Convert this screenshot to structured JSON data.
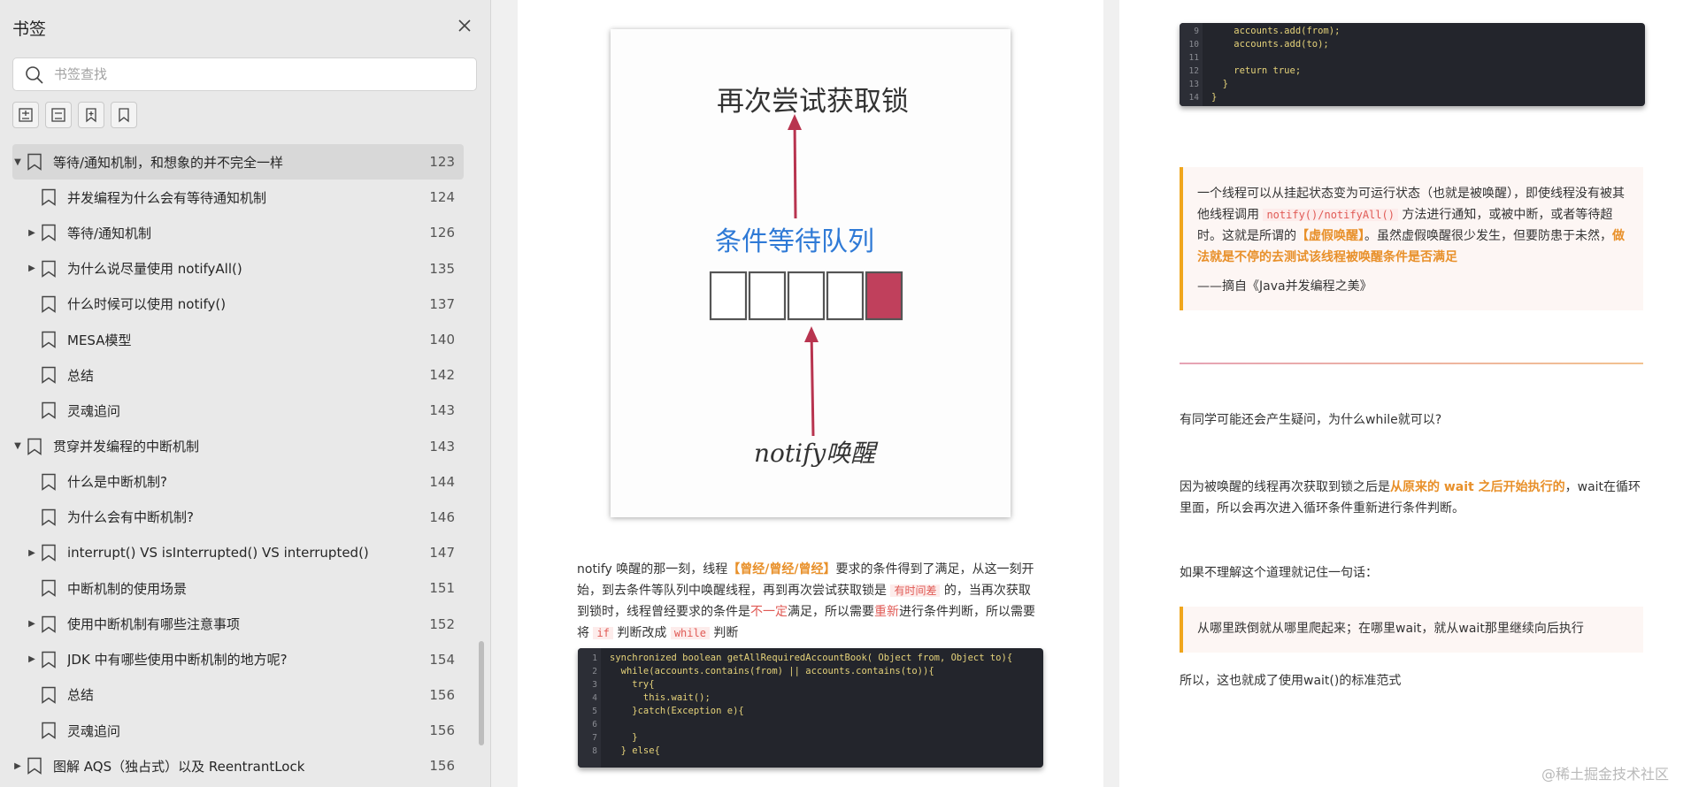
{
  "sidebar": {
    "title": "书签",
    "search_placeholder": "书签查找",
    "items": [
      {
        "label": "等待/通知机制，和想象的并不完全一样",
        "page": "123",
        "level": 0,
        "arrow": "▼",
        "selected": true
      },
      {
        "label": "并发编程为什么会有等待通知机制",
        "page": "124",
        "level": 1,
        "arrow": ""
      },
      {
        "label": "等待/通知机制",
        "page": "126",
        "level": 1,
        "arrow": "▶"
      },
      {
        "label": "为什么说尽量使用 notifyAll()",
        "page": "135",
        "level": 1,
        "arrow": "▶"
      },
      {
        "label": "什么时候可以使用 notify()",
        "page": "137",
        "level": 1,
        "arrow": ""
      },
      {
        "label": "MESA模型",
        "page": "140",
        "level": 1,
        "arrow": ""
      },
      {
        "label": "总结",
        "page": "142",
        "level": 1,
        "arrow": ""
      },
      {
        "label": "灵魂追问",
        "page": "143",
        "level": 1,
        "arrow": ""
      },
      {
        "label": "贯穿并发编程的中断机制",
        "page": "143",
        "level": 0,
        "arrow": "▼"
      },
      {
        "label": "什么是中断机制?",
        "page": "144",
        "level": 1,
        "arrow": ""
      },
      {
        "label": "为什么会有中断机制?",
        "page": "146",
        "level": 1,
        "arrow": ""
      },
      {
        "label": "interrupt() VS isInterrupted() VS interrupted()",
        "page": "147",
        "level": 1,
        "arrow": "▶"
      },
      {
        "label": "中断机制的使用场景",
        "page": "151",
        "level": 1,
        "arrow": ""
      },
      {
        "label": "使用中断机制有哪些注意事项",
        "page": "152",
        "level": 1,
        "arrow": "▶"
      },
      {
        "label": "JDK 中有哪些使用中断机制的地方呢?",
        "page": "154",
        "level": 1,
        "arrow": "▶"
      },
      {
        "label": "总结",
        "page": "156",
        "level": 1,
        "arrow": ""
      },
      {
        "label": "灵魂追问",
        "page": "156",
        "level": 1,
        "arrow": ""
      },
      {
        "label": "图解 AQS（独占式）以及 ReentrantLock",
        "page": "156",
        "level": 0,
        "arrow": "▶"
      }
    ]
  },
  "diagram": {
    "top_label": "再次尝试获取锁",
    "middle_label": "条件等待队列",
    "bottom_label": "notify唤醒"
  },
  "left_page": {
    "para": [
      {
        "t": "notify 唤醒的那一刻，线程"
      },
      {
        "t": "【曾经/曾经/曾经】",
        "c": "hl-orange"
      },
      {
        "t": "要求的条件得到了满足，从这一刻开始，到去条件等队列中唤醒线程，再到再次尝试获取锁是 "
      },
      {
        "t": "有时间差",
        "c": "code-inline"
      },
      {
        "t": " 的，当再次获取到锁时，线程曾经要求的条件是"
      },
      {
        "t": "不一定",
        "c": "hl-red"
      },
      {
        "t": "满足，所以需要"
      },
      {
        "t": "重新",
        "c": "hl-red"
      },
      {
        "t": "进行条件判断，所以需要将 "
      },
      {
        "t": "if",
        "c": "code-inline"
      },
      {
        "t": " 判断改成 "
      },
      {
        "t": "while",
        "c": "code-inline"
      },
      {
        "t": " 判断"
      }
    ],
    "code": [
      {
        "n": "1",
        "t": "synchronized boolean getAllRequiredAccountBook( Object from, Object to){"
      },
      {
        "n": "2",
        "t": "  while(accounts.contains(from) || accounts.contains(to)){"
      },
      {
        "n": "3",
        "t": "    try{"
      },
      {
        "n": "4",
        "t": "      this.wait();"
      },
      {
        "n": "5",
        "t": "    }catch(Exception e){"
      },
      {
        "n": "6",
        "t": ""
      },
      {
        "n": "7",
        "t": "    }"
      },
      {
        "n": "8",
        "t": "  } else{"
      }
    ]
  },
  "right_page": {
    "code": [
      {
        "n": "9",
        "t": "    accounts.add(from);"
      },
      {
        "n": "10",
        "t": "    accounts.add(to);"
      },
      {
        "n": "11",
        "t": ""
      },
      {
        "n": "12",
        "t": "    return true;"
      },
      {
        "n": "13",
        "t": "  }"
      },
      {
        "n": "14",
        "t": "}"
      }
    ],
    "quote_para": [
      {
        "t": "一个线程可以从挂起状态变为可运行状态（也就是被唤醒），即使线程没有被其他线程调用 "
      },
      {
        "t": "notify()/notifyAll()",
        "c": "code-inline"
      },
      {
        "t": " 方法进行通知，或被中断，或者等待超时。这就是所谓的"
      },
      {
        "t": "【虚假唤醒】",
        "c": "hl-orange"
      },
      {
        "t": "。虽然虚假唤醒很少发生，但要防患于未然，"
      },
      {
        "t": "做法就是不停的去测试该线程被唤醒条件是否满足",
        "c": "hl-orange"
      }
    ],
    "quote_source": "——摘自《Java并发编程之美》",
    "q_text": "有同学可能还会产生疑问，为什么while就可以?",
    "ans_para": [
      {
        "t": "因为被唤醒的线程再次获取到锁之后是"
      },
      {
        "t": "从原来的 wait 之后开始执行的",
        "c": "hl-orange"
      },
      {
        "t": "，wait在循环里面，所以会再次进入循环条件重新进行条件判断。"
      }
    ],
    "remember_text": "如果不理解这个道理就记住一句话：",
    "quote2": "从哪里跌倒就从哪里爬起来；在哪里wait，就从wait那里继续向后执行",
    "final_text": "所以，这也就成了使用wait()的标准范式"
  },
  "watermark": "@稀土掘金技术社区",
  "colors": {
    "accent_orange": "#f0a61c",
    "queue_red": "#c0405c",
    "arrow_red": "#b8344f",
    "label_blue": "#2f7ad6"
  }
}
